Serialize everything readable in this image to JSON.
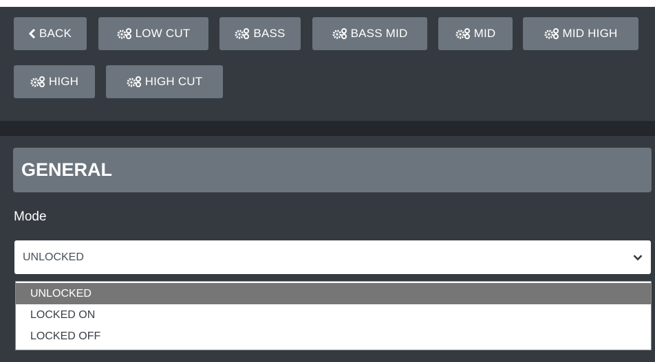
{
  "toolbar": {
    "buttons": [
      {
        "label": "BACK",
        "icon": "chevron-left-icon"
      },
      {
        "label": "LOW CUT",
        "icon": "gears-icon"
      },
      {
        "label": "BASS",
        "icon": "gears-icon"
      },
      {
        "label": "BASS MID",
        "icon": "gears-icon"
      },
      {
        "label": "MID",
        "icon": "gears-icon"
      },
      {
        "label": "MID HIGH",
        "icon": "gears-icon"
      },
      {
        "label": "HIGH",
        "icon": "gears-icon"
      },
      {
        "label": "HIGH CUT",
        "icon": "gears-icon"
      }
    ]
  },
  "section": {
    "title": "GENERAL"
  },
  "mode": {
    "label": "Mode",
    "selected": "UNLOCKED",
    "options": [
      "UNLOCKED",
      "LOCKED ON",
      "LOCKED OFF"
    ]
  },
  "colors": {
    "background": "#343a40",
    "button": "#6c757d",
    "selected_option": "#767676"
  }
}
